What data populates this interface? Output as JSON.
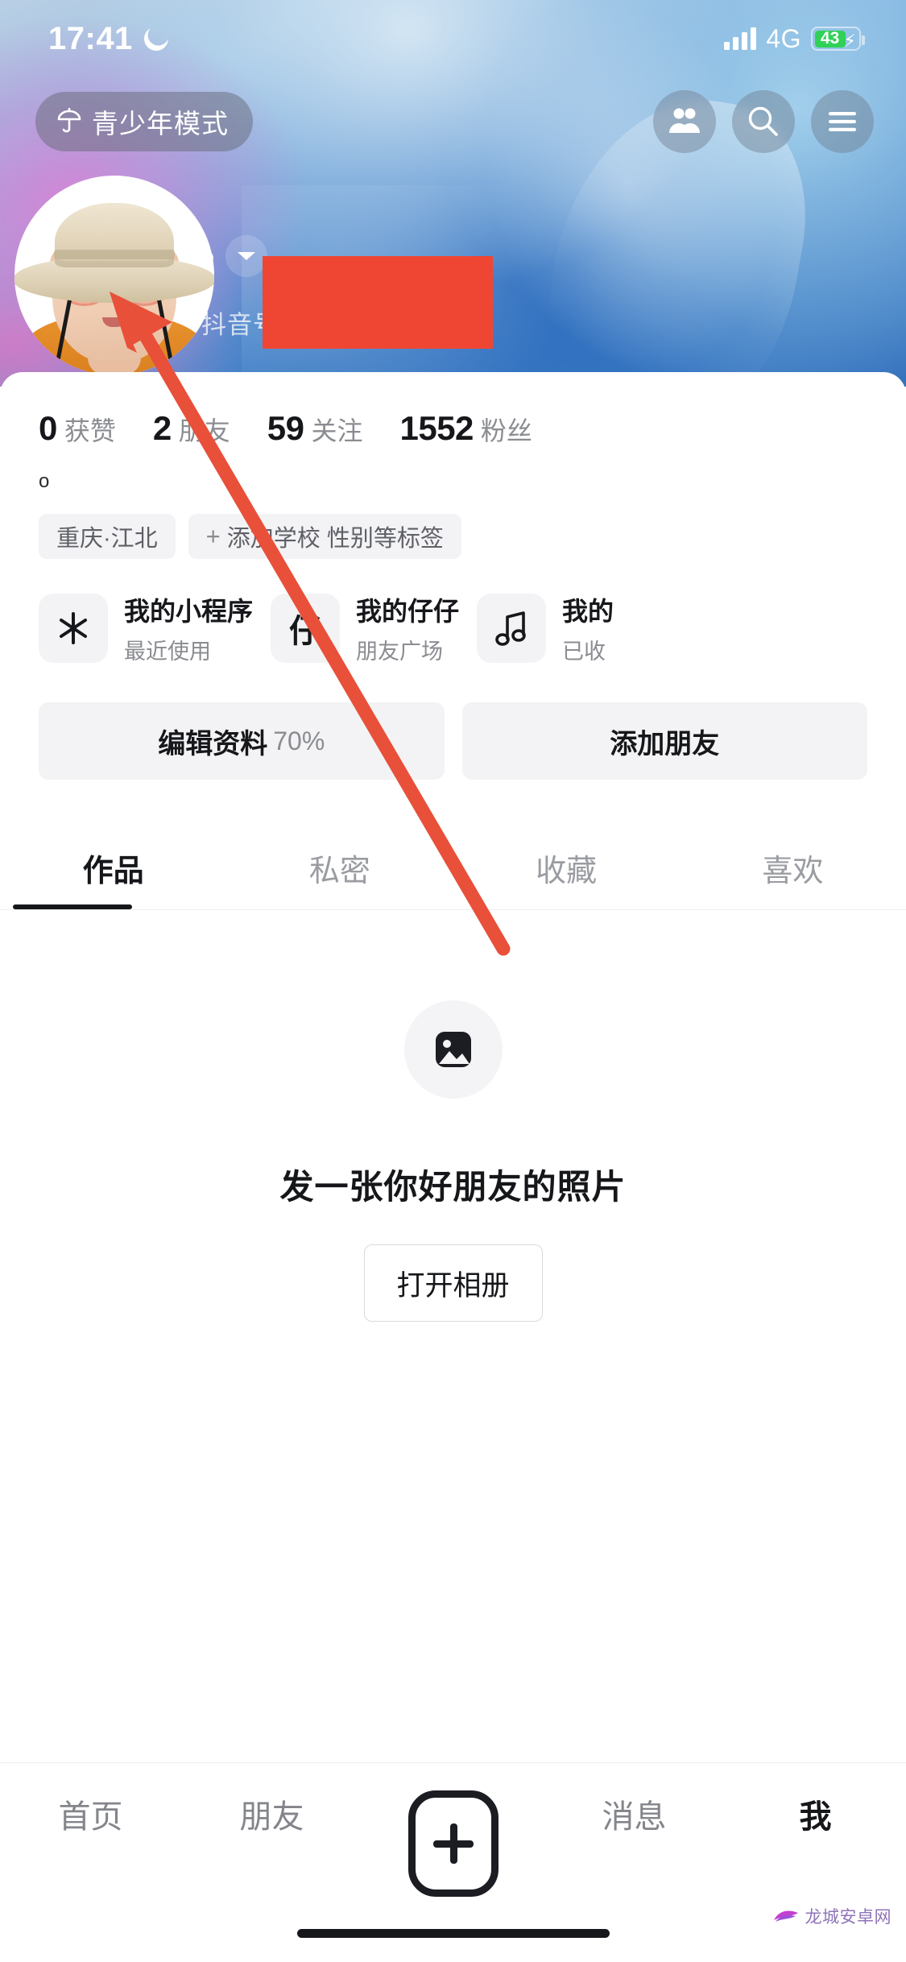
{
  "status_bar": {
    "time": "17:41",
    "moon_icon": "crescent-moon-icon",
    "network": "4G",
    "battery_level": "43",
    "charging": true,
    "signal_icon": "cellular-signal-icon"
  },
  "top_bar": {
    "teen_mode_label": "青少年模式",
    "teen_mode_icon": "umbrella-icon",
    "actions": [
      {
        "name": "friends-icon"
      },
      {
        "name": "search-icon"
      },
      {
        "name": "menu-icon"
      }
    ]
  },
  "profile": {
    "avatar_icon": "user-avatar",
    "display_name": "o",
    "chevron_icon": "chevron-down-icon",
    "douyin_id_label": "抖音号",
    "douyin_id_value": "",
    "redacted": true,
    "redaction_color": "#ef4634",
    "bio": "o"
  },
  "stats": [
    {
      "value": "0",
      "label": "获赞"
    },
    {
      "value": "2",
      "label": "朋友"
    },
    {
      "value": "59",
      "label": "关注"
    },
    {
      "value": "1552",
      "label": "粉丝"
    }
  ],
  "tags": [
    {
      "label": "重庆·江北",
      "has_plus": false
    },
    {
      "label": "添加学校  性别等标签",
      "has_plus": true,
      "plus": "+"
    }
  ],
  "mini_cards": [
    {
      "icon": "asterisk-icon",
      "icon_text": "",
      "title": "我的小程序",
      "subtitle": "最近使用"
    },
    {
      "icon": "zaizai-icon",
      "icon_text": "仔",
      "title": "我的仔仔",
      "subtitle": "朋友广场"
    },
    {
      "icon": "music-note-icon",
      "icon_text": "",
      "title": "我的",
      "subtitle": "已收"
    }
  ],
  "actions": {
    "edit_profile_label": "编辑资料",
    "edit_profile_percent": "70%",
    "add_friend_label": "添加朋友"
  },
  "tabs": [
    {
      "label": "作品",
      "active": true
    },
    {
      "label": "私密",
      "active": false
    },
    {
      "label": "收藏",
      "active": false
    },
    {
      "label": "喜欢",
      "active": false
    }
  ],
  "empty_state": {
    "icon": "image-placeholder-icon",
    "message": "发一张你好朋友的照片",
    "button_label": "打开相册"
  },
  "bottom_nav": [
    {
      "label": "首页",
      "active": false
    },
    {
      "label": "朋友",
      "active": false
    },
    {
      "label": "",
      "active": false,
      "icon": "plus-create-icon"
    },
    {
      "label": "消息",
      "active": false
    },
    {
      "label": "我",
      "active": true
    }
  ],
  "annotation": {
    "type": "arrow",
    "color": "#e8503a",
    "points_to": "avatar"
  },
  "watermark": {
    "text": "龙城安卓网",
    "color": "#8f74b8"
  }
}
